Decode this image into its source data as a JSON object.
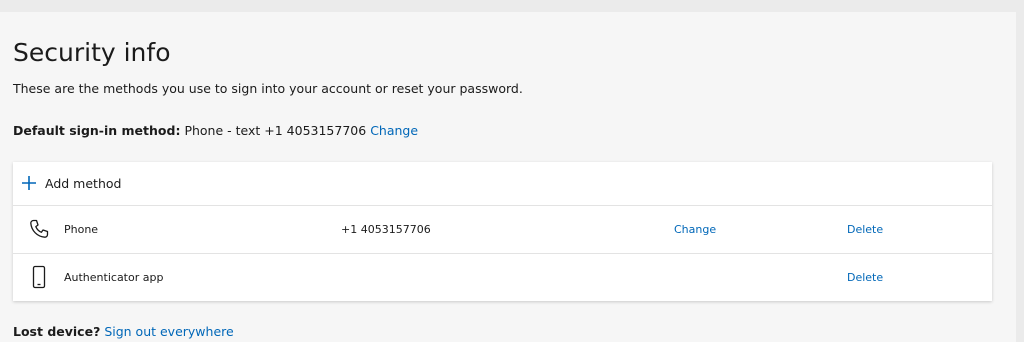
{
  "header": {
    "title": "Security info",
    "description": "These are the methods you use to sign into your account or reset your password."
  },
  "default_method": {
    "label": "Default sign-in method:",
    "value": "Phone - text +1 4053157706",
    "change_label": "Change"
  },
  "add_method": {
    "label": "Add method",
    "icon": "plus-icon"
  },
  "methods": [
    {
      "icon": "phone-icon",
      "name": "Phone",
      "value": "+1 4053157706",
      "change_label": "Change",
      "delete_label": "Delete"
    },
    {
      "icon": "mobile-device-icon",
      "name": "Authenticator app",
      "value": "",
      "change_label": "",
      "delete_label": "Delete"
    }
  ],
  "footer": {
    "lost_device_label": "Lost device?",
    "sign_out_label": "Sign out everywhere"
  },
  "colors": {
    "link": "#0067b8",
    "page_background": "#f6f6f6",
    "card_background": "#ffffff"
  }
}
